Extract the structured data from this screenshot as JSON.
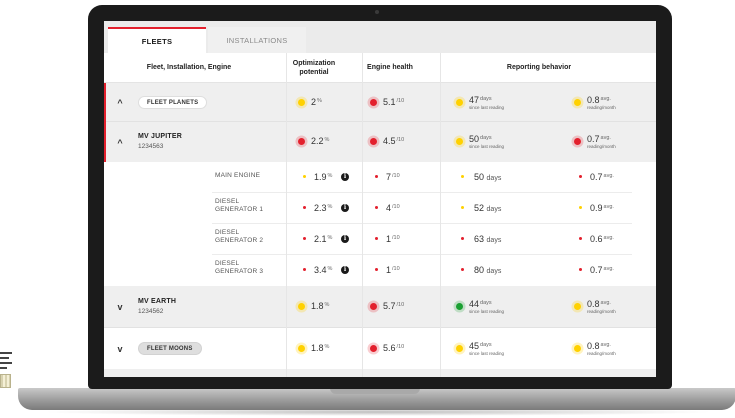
{
  "tabs": [
    {
      "label": "FLEETS",
      "active": true
    },
    {
      "label": "INSTALLATIONS",
      "active": false
    }
  ],
  "columns": {
    "name": "Fleet, Installation, Engine",
    "optimization": "Optimization\npotential",
    "engine_health": "Engine health",
    "reporting": "Reporting behavior"
  },
  "colors": {
    "accent": "#e3202d",
    "status_yellow": "#ffd100",
    "status_red": "#e3202d",
    "status_green": "#1aa032"
  },
  "rows": {
    "fleet_planets": {
      "label": "FLEET PLANETS",
      "optimization": {
        "value": "2",
        "unit": "%",
        "status": "yellow"
      },
      "health": {
        "value": "5.1",
        "unit": "/10",
        "status": "red"
      },
      "days": {
        "value": "47",
        "unit": "days",
        "caption": "since last reading",
        "status": "yellow"
      },
      "avg": {
        "value": "0.8",
        "unit": "avg.",
        "caption": "reading/month",
        "status": "yellow"
      }
    },
    "mv_jupiter": {
      "name": "MV JUPITER",
      "id": "1234563",
      "optimization": {
        "value": "2.2",
        "unit": "%",
        "status": "red"
      },
      "health": {
        "value": "4.5",
        "unit": "/10",
        "status": "red"
      },
      "days": {
        "value": "50",
        "unit": "days",
        "caption": "since last reading",
        "status": "yellow"
      },
      "avg": {
        "value": "0.7",
        "unit": "avg.",
        "caption": "reading/month",
        "status": "red"
      }
    },
    "engines": [
      {
        "name": "MAIN ENGINE",
        "opt": "1.9",
        "opt_unit": "%",
        "opt_status": "yellow",
        "health": "7",
        "health_unit": "/10",
        "health_status": "red",
        "days": "50",
        "days_unit": "days",
        "days_status": "yellow",
        "avg": "0.7",
        "avg_unit": "avg.",
        "avg_status": "red"
      },
      {
        "name": "DIESEL\nGENERATOR 1",
        "opt": "2.3",
        "opt_unit": "%",
        "opt_status": "red",
        "health": "4",
        "health_unit": "/10",
        "health_status": "red",
        "days": "52",
        "days_unit": "days",
        "days_status": "yellow",
        "avg": "0.9",
        "avg_unit": "avg.",
        "avg_status": "yellow"
      },
      {
        "name": "DIESEL\nGENERATOR 2",
        "opt": "2.1",
        "opt_unit": "%",
        "opt_status": "red",
        "health": "1",
        "health_unit": "/10",
        "health_status": "red",
        "days": "63",
        "days_unit": "days",
        "days_status": "red",
        "avg": "0.6",
        "avg_unit": "avg.",
        "avg_status": "red"
      },
      {
        "name": "DIESEL\nGENERATOR 3",
        "opt": "3.4",
        "opt_unit": "%",
        "opt_status": "red",
        "health": "1",
        "health_unit": "/10",
        "health_status": "red",
        "days": "80",
        "days_unit": "days",
        "days_status": "red",
        "avg": "0.7",
        "avg_unit": "avg.",
        "avg_status": "red"
      }
    ],
    "info_icon": "i",
    "mv_earth": {
      "name": "MV EARTH",
      "id": "1234562",
      "optimization": {
        "value": "1.8",
        "unit": "%",
        "status": "yellow"
      },
      "health": {
        "value": "5.7",
        "unit": "/10",
        "status": "red"
      },
      "days": {
        "value": "44",
        "unit": "days",
        "caption": "since last reading",
        "status": "green"
      },
      "avg": {
        "value": "0.8",
        "unit": "avg.",
        "caption": "reading/month",
        "status": "yellow"
      }
    },
    "fleet_moons": {
      "label": "FLEET MOONS",
      "optimization": {
        "value": "1.8",
        "unit": "%",
        "status": "yellow"
      },
      "health": {
        "value": "5.6",
        "unit": "/10",
        "status": "red"
      },
      "days": {
        "value": "45",
        "unit": "days",
        "caption": "since last reading",
        "status": "yellow"
      },
      "avg": {
        "value": "0.8",
        "unit": "avg.",
        "caption": "reading/month",
        "status": "yellow"
      }
    }
  },
  "icons": {
    "expanded": "chevron-up-icon",
    "collapsed": "chevron-down-icon",
    "info": "info-icon",
    "chevron_up_glyph": "^",
    "chevron_down_glyph": "v"
  }
}
